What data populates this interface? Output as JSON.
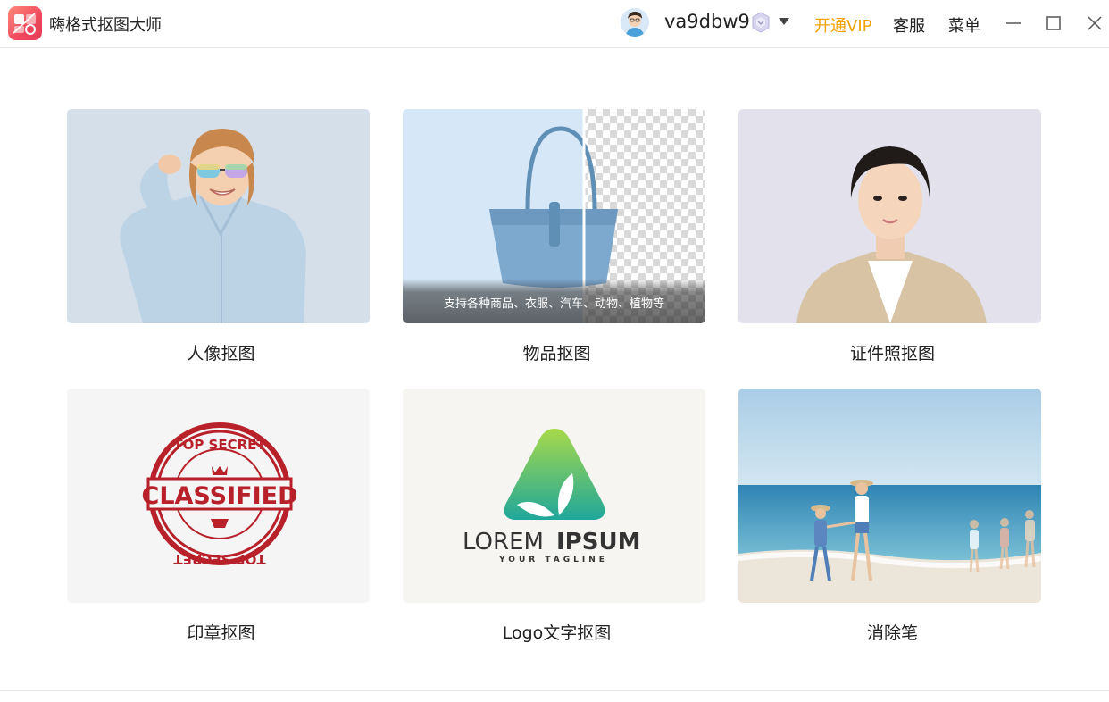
{
  "app": {
    "title": "嗨格式抠图大师",
    "logo_icon": "scissors-logo-icon",
    "brand_color": "#f0495e"
  },
  "header": {
    "username": "va9dbw9",
    "vip_label": "开通VIP",
    "vip_color": "#f2a100",
    "service_label": "客服",
    "menu_label": "菜单"
  },
  "cards": [
    {
      "label": "人像抠图"
    },
    {
      "label": "物品抠图",
      "caption": "支持各种商品、衣服、汽车、动物、植物等"
    },
    {
      "label": "证件照抠图"
    },
    {
      "label": "印章抠图",
      "stamp": {
        "top_text": "TOP SECRET",
        "center_text": "CLASSIFIED",
        "bottom_text": "TOP SECRET"
      }
    },
    {
      "label": "Logo文字抠图",
      "logo": {
        "word1": "LOREM",
        "word2": "IPSUM",
        "tagline": "YOUR TAGLINE"
      }
    },
    {
      "label": "消除笔"
    }
  ]
}
